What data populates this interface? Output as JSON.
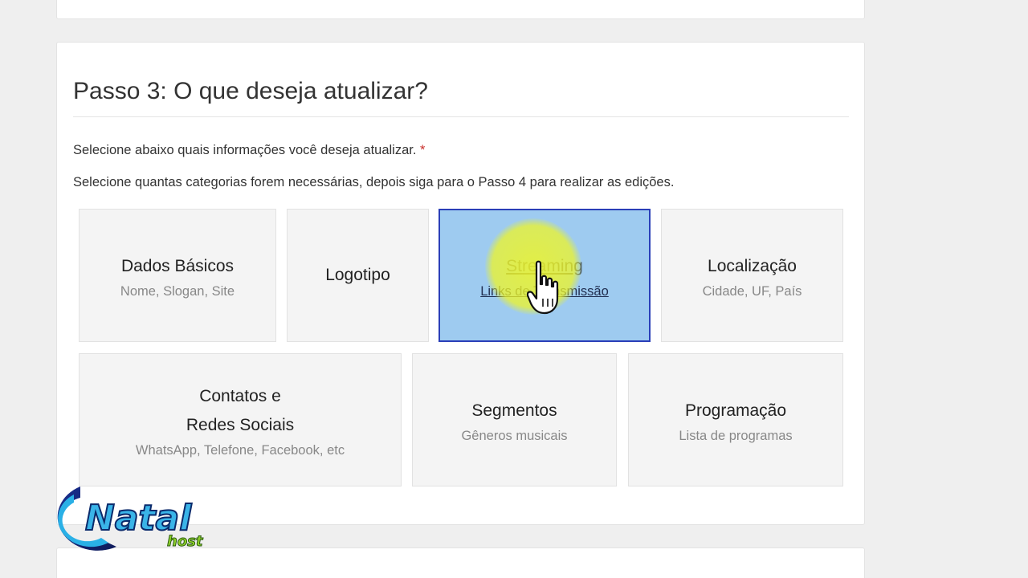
{
  "step": {
    "title": "Passo 3: O que deseja atualizar?",
    "instruction1": "Selecione abaixo quais informações você deseja atualizar.",
    "required_mark": "*",
    "instruction2": "Selecione quantas categorias forem necessárias, depois siga para o Passo 4 para realizar as edições."
  },
  "cards": [
    {
      "title": "Dados Básicos",
      "subtitle": "Nome, Slogan, Site"
    },
    {
      "title": "Logotipo",
      "subtitle": ""
    },
    {
      "title": "Streaming",
      "subtitle": "Links de Transmissão"
    },
    {
      "title": "Localização",
      "subtitle": "Cidade, UF, País"
    },
    {
      "title_line1": "Contatos e",
      "title_line2": "Redes Sociais",
      "subtitle": "WhatsApp, Telefone, Facebook, etc"
    },
    {
      "title": "Segmentos",
      "subtitle": "Gêneros musicais"
    },
    {
      "title": "Programação",
      "subtitle": "Lista de programas"
    }
  ],
  "selected_card": "Streaming",
  "logo": {
    "text": "Natal",
    "subtext": "host"
  },
  "colors": {
    "selected_bg": "#9ecbf0",
    "selected_border": "#2a3fb8",
    "required": "#c9302c",
    "highlight": "#eef528"
  }
}
